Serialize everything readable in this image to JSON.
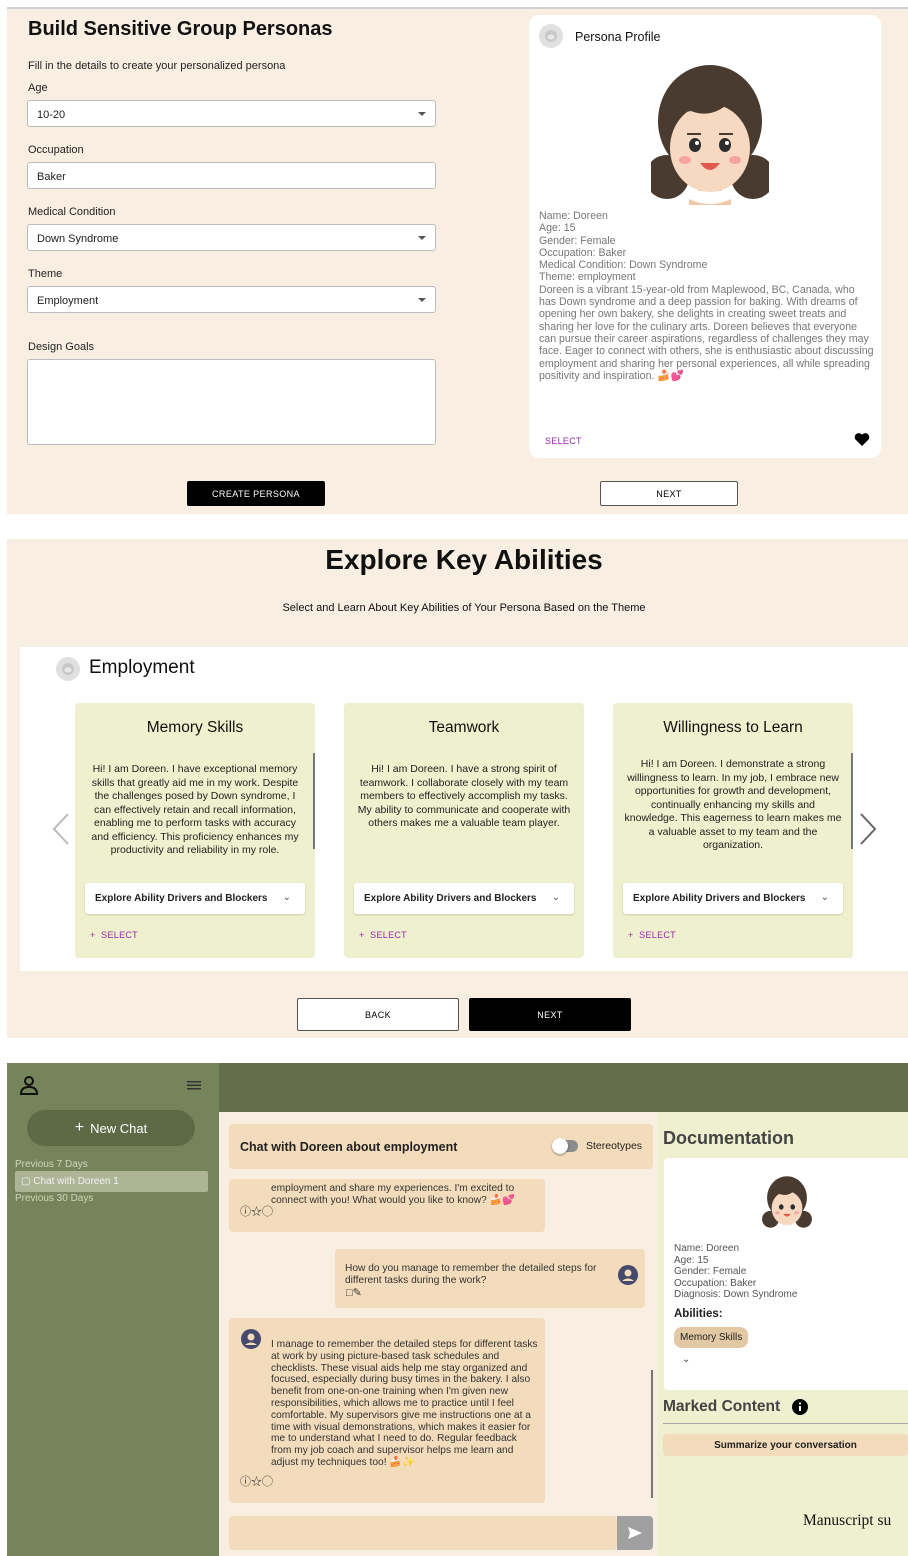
{
  "form": {
    "title": "Build Sensitive Group Personas",
    "subtitle": "Fill in the details to create your personalized persona",
    "age_label": "Age",
    "age_value": "10-20",
    "occupation_label": "Occupation",
    "occupation_value": "Baker",
    "medical_label": "Medical Condition",
    "medical_value": "Down Syndrome",
    "theme_label": "Theme",
    "theme_value": "Employment",
    "goals_label": "Design Goals",
    "goals_value": "",
    "create_button": "CREATE PERSONA",
    "next_button": "NEXT"
  },
  "profile": {
    "header": "Persona Profile",
    "name": "Name: Doreen",
    "age": "Age: 15",
    "gender": "Gender: Female",
    "occupation": "Occupation: Baker",
    "medical": "Medical Condition: Down Syndrome",
    "theme": "Theme: employment",
    "bio": "Doreen is a vibrant 15-year-old from Maplewood, BC, Canada, who has Down syndrome and a deep passion for baking. With dreams of opening her own bakery, she delights in creating sweet treats and sharing her love for the culinary arts. Doreen believes that everyone can pursue their career aspirations, regardless of challenges they may face. Eager to connect with others, she is enthusiastic about discussing employment and sharing her personal experiences, all while spreading positivity and inspiration. 🍰💕",
    "select_label": "SELECT"
  },
  "abilities": {
    "title": "Explore Key Abilities",
    "subtitle": "Select and Learn About Key Abilities of Your Persona Based on the Theme",
    "theme": "Employment",
    "accordion_label": "Explore Ability Drivers and Blockers",
    "select_label": "SELECT",
    "back_button": "BACK",
    "next_button": "NEXT",
    "cards": [
      {
        "title": "Memory Skills",
        "body": "Hi! I am Doreen. I have exceptional memory skills that greatly aid me in my work. Despite the challenges posed by Down syndrome, I can effectively retain and recall information, enabling me to perform tasks with accuracy and efficiency. This proficiency enhances my productivity and reliability in my role."
      },
      {
        "title": "Teamwork",
        "body": "Hi! I am Doreen. I have a strong spirit of teamwork. I collaborate closely with my team members to effectively accomplish my tasks. My ability to communicate and cooperate with others makes me a valuable team player."
      },
      {
        "title": "Willingness to Learn",
        "body": "Hi! I am Doreen. I demonstrate a strong willingness to learn. In my job, I embrace new opportunities for growth and development, continually enhancing my skills and knowledge. This eagerness to learn makes me a valuable asset to my team and the organization."
      }
    ]
  },
  "chat": {
    "new_chat": "New Chat",
    "prev7": "Previous 7 Days",
    "chat_item": "Chat with Doreen 1",
    "prev30": "Previous 30 Days",
    "header": "Chat with Doreen about employment",
    "toggle_label": "Stereotypes",
    "msg1": "employment and share my experiences. I'm excited to connect with you! What would you like to know? 🍰💕",
    "msg2": "How do you manage to remember the detailed steps for different tasks during the work?",
    "msg3": "I manage to remember the detailed steps for different tasks at work by using picture-based task schedules and checklists. These visual aids help me stay organized and focused, especially during busy times in the bakery. I also benefit from one-on-one training when I'm given new responsibilities, which allows me to practice until I feel comfortable. My supervisors give me instructions one at a time with visual demonstrations, which makes it easier for me to understand what I need to do. Regular feedback from my job coach and supervisor helps me learn and adjust my techniques too! 🍰✨",
    "input_placeholder": ""
  },
  "documentation": {
    "title": "Documentation",
    "name": "Name: Doreen",
    "age": "Age: 15",
    "gender": "Gender: Female",
    "occupation": "Occupation: Baker",
    "diagnosis": "Diagnosis: Down Syndrome",
    "abilities_label": "Abilities:",
    "ability_chip": "Memory Skills",
    "marked_title": "Marked Content",
    "summarize_button": "Summarize your conversation",
    "footer_text": "Manuscript su"
  },
  "colors": {
    "beige": "#f8eee2",
    "card_green": "#eff0cd",
    "sidebar_green": "#76845b",
    "topbar_green": "#646e4b",
    "bubble": "#f3dcbb",
    "accent_purple": "#9c27b0"
  }
}
